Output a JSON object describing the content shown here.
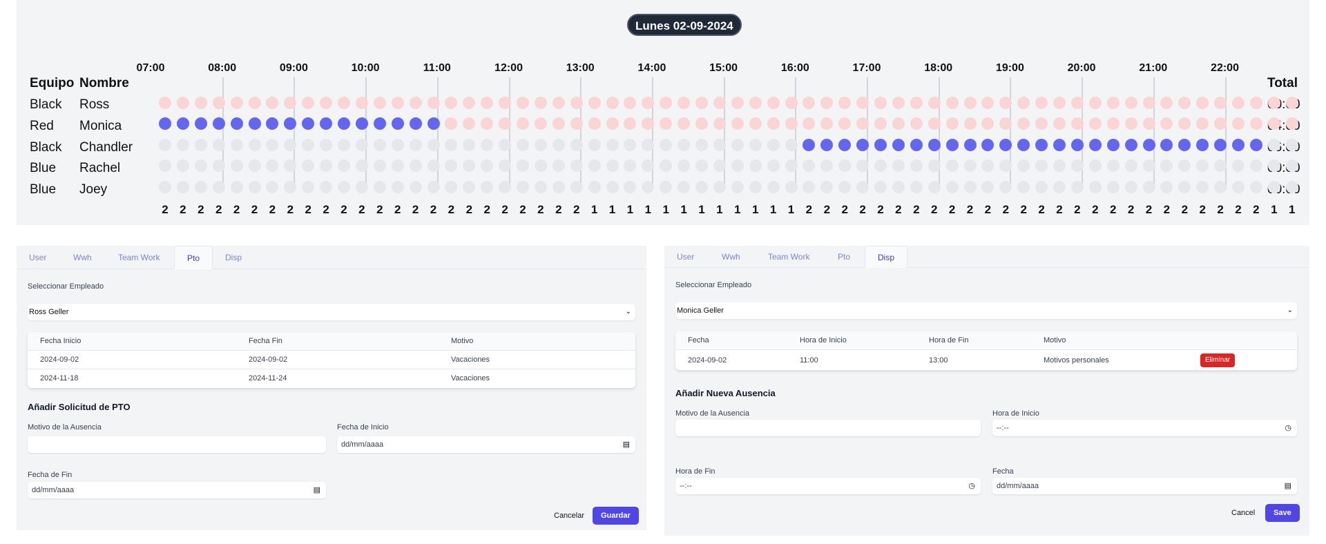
{
  "schedule": {
    "date": "Lunes 02-09-2024",
    "headers": {
      "team": "Equipo",
      "name": "Nombre",
      "total": "Total"
    },
    "hours": [
      "07:00",
      "08:00",
      "09:00",
      "10:00",
      "11:00",
      "12:00",
      "13:00",
      "14:00",
      "15:00",
      "16:00",
      "17:00",
      "18:00",
      "19:00",
      "20:00",
      "21:00",
      "22:00"
    ],
    "rows": [
      {
        "team": "Black",
        "name": "Ross",
        "total": "00:00"
      },
      {
        "team": "Red",
        "name": "Monica",
        "total": "04:00"
      },
      {
        "team": "Black",
        "name": "Chandler",
        "total": "06:00"
      },
      {
        "team": "Blue",
        "name": "Rachel",
        "total": "00:00"
      },
      {
        "team": "Blue",
        "name": "Joey",
        "total": "00:00"
      }
    ],
    "slot_states": [
      "pppppppppppppppppppppppppppppppppppppppppppppppppppppppppppppppp",
      "ffffffffffffffffpppppppppppppppppppppppppppppppppppppppppppppppp",
      "gggggggggggggggggggggggggggggggggggggggggggggggggggggggggggggggg",
      "gggggggggggggggggggggggggggggggggggggggggggggggggggggggggggggggg",
      "gggggggggggggggggggggggggggggggggggggggggggggggggggggggggggggggg"
    ],
    "chandler_filled_range": [
      36,
      61
    ],
    "slot_counts": [
      "2",
      "2",
      "2",
      "2",
      "2",
      "2",
      "2",
      "2",
      "2",
      "2",
      "2",
      "2",
      "2",
      "2",
      "2",
      "2",
      "2",
      "2",
      "2",
      "2",
      "2",
      "2",
      "2",
      "2",
      "1",
      "1",
      "1",
      "1",
      "1",
      "1",
      "1",
      "1",
      "1",
      "1",
      "1",
      "1",
      "2",
      "2",
      "2",
      "2",
      "2",
      "2",
      "2",
      "2",
      "2",
      "2",
      "2",
      "2",
      "2",
      "2",
      "2",
      "2",
      "2",
      "2",
      "2",
      "2",
      "2",
      "2",
      "2",
      "2",
      "2",
      "2",
      "1",
      "1"
    ],
    "colors": {
      "filled": "#6366f1",
      "unavailable": "#fbd5d5",
      "empty": "#e5e7eb"
    }
  },
  "pto_panel": {
    "tabs": [
      "User",
      "Wwh",
      "Team Work",
      "Pto",
      "Disp"
    ],
    "active_tab": "Pto",
    "select_label": "Seleccionar Empleado",
    "selected_employee": "Ross Geller",
    "table_headers": [
      "Fecha Inicio",
      "Fecha Fin",
      "Motivo"
    ],
    "table_rows": [
      [
        "2024-09-02",
        "2024-09-02",
        "Vacaciones"
      ],
      [
        "2024-11-18",
        "2024-11-24",
        "Vacaciones"
      ]
    ],
    "form_title": "Añadir Solicitud de PTO",
    "reason_label": "Motivo de la Ausencia",
    "start_label": "Fecha de Inicio",
    "start_placeholder": "dd/mm/aaaa",
    "end_label": "Fecha de Fin",
    "end_placeholder": "dd/mm/aaaa",
    "cancel": "Cancelar",
    "save": "Guardar"
  },
  "disp_panel": {
    "tabs": [
      "User",
      "Wwh",
      "Team Work",
      "Pto",
      "Disp"
    ],
    "active_tab": "Disp",
    "select_label": "Seleccionar Empleado",
    "selected_employee": "Monica Geller",
    "table_headers": [
      "Fecha",
      "Hora de Inicio",
      "Hora de Fin",
      "Motivo"
    ],
    "table_rows": [
      [
        "2024-09-02",
        "11:00",
        "13:00",
        "Motivos personales"
      ]
    ],
    "delete": "Eliminar",
    "form_title": "Añadir Nueva Ausencia",
    "reason_label": "Motivo de la Ausencia",
    "start_time_label": "Hora de Inicio",
    "time_placeholder": "--:--",
    "end_time_label": "Hora de Fin",
    "date_label": "Fecha",
    "date_placeholder": "dd/mm/aaaa",
    "cancel": "Cancel",
    "save": "Save"
  }
}
